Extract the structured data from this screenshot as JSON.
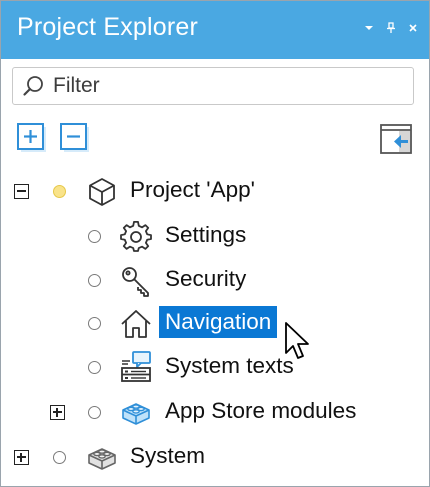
{
  "panel": {
    "title": "Project Explorer",
    "title_icons": [
      "dropdown-arrow-icon",
      "pin-icon",
      "close-icon"
    ]
  },
  "filter": {
    "placeholder": "Filter",
    "value": ""
  },
  "toolbar": {
    "expand_all_icon": "expand-all-icon",
    "collapse_all_icon": "collapse-all-icon",
    "sync_icon": "sync-editor-icon"
  },
  "tree": [
    {
      "label": "Project 'App'",
      "icon": "cube-icon",
      "expander": "collapse",
      "status": "active",
      "selected": false
    },
    {
      "label": "Settings",
      "icon": "gear-icon",
      "expander": "",
      "status": "inactive",
      "selected": false
    },
    {
      "label": "Security",
      "icon": "key-icon",
      "expander": "",
      "status": "inactive",
      "selected": false
    },
    {
      "label": "Navigation",
      "icon": "house-icon",
      "expander": "",
      "status": "inactive",
      "selected": true
    },
    {
      "label": "System texts",
      "icon": "system-texts-icon",
      "expander": "",
      "status": "inactive",
      "selected": false
    },
    {
      "label": "App Store modules",
      "icon": "blue-brick-icon",
      "expander": "expand",
      "status": "inactive",
      "selected": false
    },
    {
      "label": "System",
      "icon": "gray-brick-icon",
      "expander": "expand",
      "status": "inactive",
      "selected": false
    }
  ],
  "colors": {
    "title_bar": "#4aa8e2",
    "selection": "#0a78d4",
    "active_status": "#f9e38a",
    "toolbar_icon": "#2f8fd8"
  }
}
